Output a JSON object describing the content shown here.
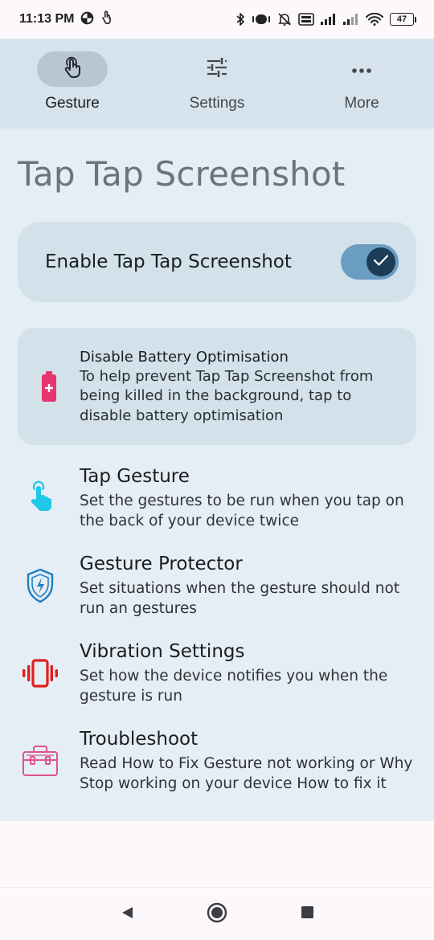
{
  "status_bar": {
    "time": "11:13 PM",
    "battery_level": "47",
    "icons": [
      "data-saver-icon",
      "hand-gesture-icon",
      "bluetooth-icon",
      "vibrate-icon",
      "mute-icon",
      "volte-icon",
      "signal-icon",
      "signal-icon",
      "wifi-icon",
      "battery-icon"
    ]
  },
  "top_nav": {
    "items": [
      {
        "label": "Gesture",
        "icon": "touch-gesture-icon",
        "active": true
      },
      {
        "label": "Settings",
        "icon": "tune-icon",
        "active": false
      },
      {
        "label": "More",
        "icon": "more-horiz-icon",
        "active": false
      }
    ]
  },
  "main": {
    "title": "Tap Tap Screenshot",
    "enable": {
      "label": "Enable Tap Tap Screenshot",
      "enabled": true
    },
    "battery_card": {
      "title": "Disable Battery Optimisation",
      "description": "To help prevent Tap Tap Screenshot from being killed in the background, tap to disable battery optimisation",
      "icon": "battery-plus-icon"
    },
    "items": [
      {
        "title": "Tap Gesture",
        "description": "Set the gestures to be run when you tap on the back of your device twice",
        "icon": "tap-finger-icon"
      },
      {
        "title": "Gesture Protector",
        "description": "Set situations when the gesture should not run an gestures",
        "icon": "shield-bolt-icon"
      },
      {
        "title": "Vibration Settings",
        "description": "Set how the device notifies you when the gesture is run",
        "icon": "vibration-icon"
      },
      {
        "title": "Troubleshoot",
        "description": "Read How to Fix Gesture not working or Why Stop working on your device How to fix it",
        "icon": "toolbox-icon"
      }
    ]
  },
  "colors": {
    "nav_background": "#d6e3ed",
    "content_background": "#e5eef4",
    "card_background": "#d3e1eb",
    "toggle_track": "#6b9cc2",
    "toggle_thumb": "#1c3d55",
    "battery_icon": "#e8356d",
    "tap_icon": "#1fc7e8",
    "shield_icon": "#1f7ec2",
    "vibration_icon": "#e01e1e",
    "toolbox_icon": "#e0538e"
  },
  "system_nav": {
    "buttons": [
      "back-icon",
      "home-icon",
      "recents-icon"
    ]
  }
}
